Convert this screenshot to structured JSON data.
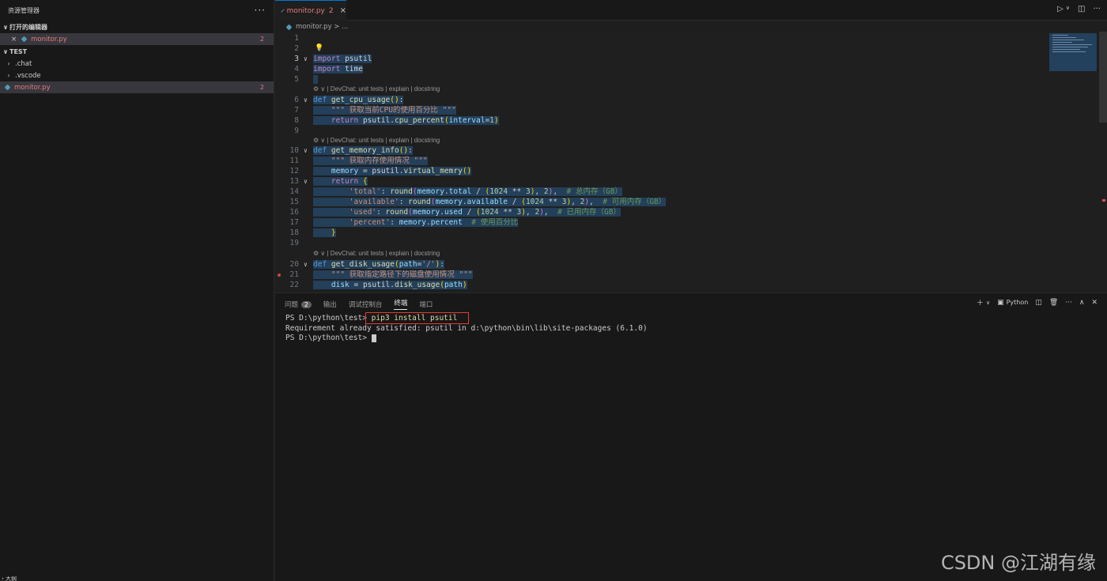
{
  "sidebar": {
    "title": "资源管理器",
    "more": "···",
    "open_editors": "打开的编辑器",
    "open_file": "monitor.py",
    "open_file_badge": "2",
    "folder": "TEST",
    "items": [
      {
        "label": ".chat"
      },
      {
        "label": ".vscode"
      },
      {
        "label": "monitor.py",
        "badge": "2"
      }
    ],
    "outline": "大纲"
  },
  "tab": {
    "label": "monitor.py",
    "badge": "2",
    "close": "×"
  },
  "breadcrumb": "monitor.py > ...",
  "codelens": "| DevChat: unit tests | explain | docstring",
  "code_lines": [
    {
      "n": "1",
      "t": ""
    },
    {
      "n": "2",
      "t": ""
    },
    {
      "n": "3",
      "t": "import psutil"
    },
    {
      "n": "4",
      "t": "import time"
    },
    {
      "n": "5",
      "t": ""
    },
    {
      "n": "6",
      "t": "def get_cpu_usage():"
    },
    {
      "n": "7",
      "t": "    \"\"\" 获取当前CPU的使用百分比 \"\"\""
    },
    {
      "n": "8",
      "t": "    return psutil.cpu_percent(interval=1)"
    },
    {
      "n": "9",
      "t": ""
    },
    {
      "n": "10",
      "t": "def get_memory_info():"
    },
    {
      "n": "11",
      "t": "    \"\"\" 获取内存使用情况 \"\"\""
    },
    {
      "n": "12",
      "t": "    memory = psutil.virtual_memry()"
    },
    {
      "n": "13",
      "t": "    return {"
    },
    {
      "n": "14",
      "t": "        'total': round(memory.total / (1024 ** 3), 2),  # 总内存（GB）"
    },
    {
      "n": "15",
      "t": "        'available': round(memory.available / (1024 ** 3), 2),  # 可用内存（GB）"
    },
    {
      "n": "16",
      "t": "        'used': round(memory.used / (1024 ** 3), 2),  # 已用内存（GB）"
    },
    {
      "n": "17",
      "t": "        'percent': memory.percent  # 使用百分比"
    },
    {
      "n": "18",
      "t": "    }"
    },
    {
      "n": "19",
      "t": ""
    },
    {
      "n": "20",
      "t": "def get_disk_usage(path='/'):"
    },
    {
      "n": "21",
      "t": "    \"\"\" 获取指定路径下的磁盘使用情况 \"\"\""
    },
    {
      "n": "22",
      "t": "    disk = psutil.disk_usage(path)"
    }
  ],
  "panel": {
    "tabs": [
      "问题",
      "输出",
      "调试控制台",
      "终端",
      "端口"
    ],
    "problems_badge": "2",
    "active_tab": "终端",
    "shell_label": "Python",
    "terminal": {
      "prompt1": "PS D:\\python\\test> ",
      "command": "pip3 install psutil",
      "output": "Requirement already satisfied: psutil in d:\\python\\bin\\lib\\site-packages (6.1.0)",
      "prompt2": "PS D:\\python\\test> "
    }
  },
  "watermark": "CSDN @江湖有缘"
}
